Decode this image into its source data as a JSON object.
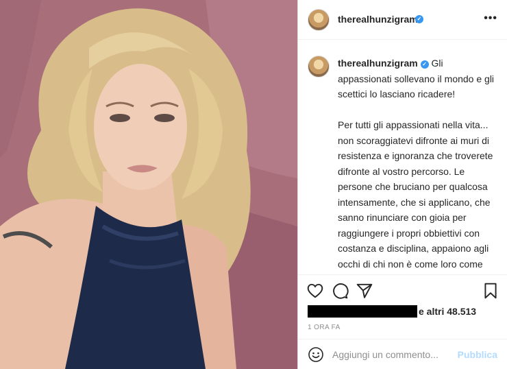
{
  "post": {
    "username": "therealhunzigram",
    "verified_mark": "✓",
    "more_label": "•••",
    "caption": "Gli appassionati sollevano il mondo e gli scettici lo lasciano ricadere!\n\nPer tutti gli appassionati nella vita... non scoraggiatevi difronte ai muri di resistenza e ignoranza che troverete difronte al vostro percorso. Le persone che bruciano per qualcosa intensamente, che si applicano, che sanno rinunciare con gioia per raggiungere i propri obbiettivi con costanza e disciplina, appaiono agli occhi di chi non è come loro come degli “invasati” e vengono spesso come capita a me giudicati. Ci sono persone che preferiscono vivere nel proprio metro quadro delle loro piccole certezze acquisite, quelli che",
    "likes_text": "e altri 48.513",
    "time": "1 ORA FA"
  },
  "icons": {
    "like": "heart-icon",
    "comment": "comment-icon",
    "share": "share-icon",
    "save": "bookmark-icon",
    "emoji": "emoji-icon",
    "more": "more-icon"
  },
  "comment": {
    "placeholder": "Aggiungi un commento...",
    "publish_label": "Pubblica"
  },
  "colors": {
    "verified": "#3897f0",
    "publish_disabled": "#b3dbff",
    "muted": "#8e8e8e"
  }
}
